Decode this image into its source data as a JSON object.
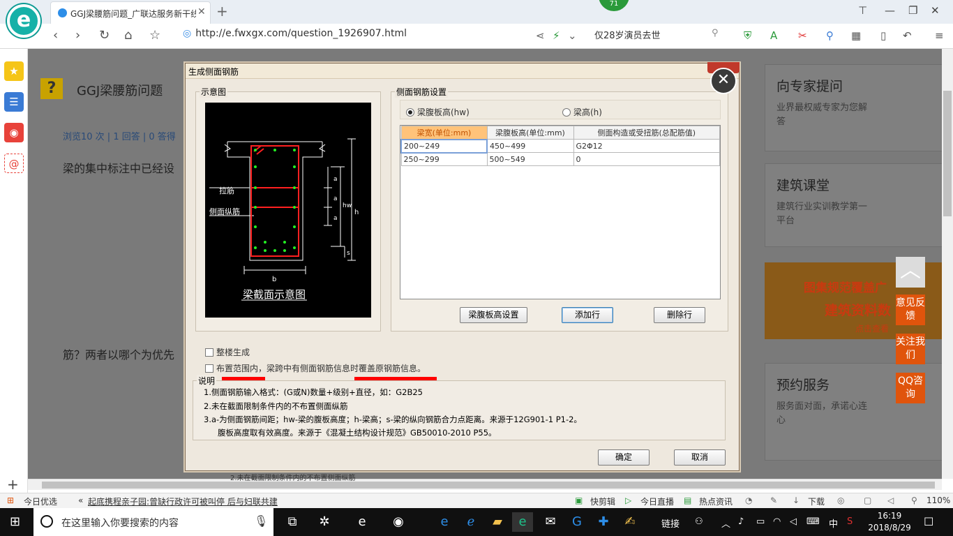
{
  "browser": {
    "tab_title": "GGJ梁腰筋问题_广联达服务新干线",
    "url": "http://e.fwxgx.com/question_1926907.html",
    "hot_search": "仅28岁演员去世",
    "badge": "71"
  },
  "page": {
    "title": "GGJ梁腰筋问题",
    "meta": "浏览10 次 | 1 回答 | 0 答得",
    "body_line1": "梁的集中标注中已经设",
    "body_line2": "筋？两者以哪个为优先"
  },
  "right_cards": [
    {
      "heading": "向专家提问",
      "sub": "业界最权威专家为您解答"
    },
    {
      "heading": "建筑课堂",
      "sub": "建筑行业实训教学第一平台"
    },
    {
      "heading": "预约服务",
      "sub": "服务面对面，承诺心连心"
    }
  ],
  "banner": {
    "line1": "图集规范覆盖广",
    "line2": "建筑资料数",
    "line3": "点击查看"
  },
  "float_buttons": [
    "意见反馈",
    "关注我们",
    "QQ咨询"
  ],
  "dialog": {
    "title": "生成侧面钢筋",
    "schematic_label": "示意图",
    "schematic_caption": "梁截面示意图",
    "schematic_tags": {
      "tie": "拉筋",
      "side": "侧面纵筋",
      "a": "a",
      "hw": "hw",
      "h": "h",
      "s": "s",
      "b": "b"
    },
    "settings_label": "侧面钢筋设置",
    "radio_web_height": "梁腹板高(hw)",
    "radio_beam_height": "梁高(h)",
    "grid_headers": [
      "梁宽(单位:mm)",
      "梁腹板高(单位:mm)",
      "侧面构造或受扭筋(总配筋值)"
    ],
    "grid_rows": [
      [
        "200~249",
        "450~499",
        "G2Φ12"
      ],
      [
        "250~299",
        "500~549",
        "0"
      ]
    ],
    "btn_web_height": "梁腹板高设置",
    "btn_add_row": "添加行",
    "btn_delete_row": "删除行",
    "chk_whole_building": "整楼生成",
    "chk_cover": "布置范围内，梁跨中有侧面钢筋信息时覆盖原钢筋信息。",
    "notes_label": "说明",
    "notes": [
      "1.侧面钢筋输入格式：(G或N)数量+级别+直径，如：G2B25",
      "2.未在截面限制条件内的不布置侧面纵筋",
      "3.a-为侧面钢筋间距；hw-梁的腹板高度；h-梁高；s-梁的纵向钢筋合力点距离。来源于12G901-1 P1-2。",
      "腹板高度取有效高度。来源于《混凝土结构设计规范》GB50010-2010 P55。"
    ],
    "btn_ok": "确定",
    "btn_cancel": "取消",
    "hidden_behind": "2.未在截面限制条件内的不布置侧面纵筋"
  },
  "statusbar": {
    "news_label": "今日优选",
    "news_text": "起底携程亲子园:曾缺行政许可被叫停 后与妇联共建",
    "items": [
      "快剪辑",
      "今日直播",
      "热点资讯",
      "下载"
    ],
    "zoom": "110%"
  },
  "taskbar": {
    "search_placeholder": "在这里输入你要搜索的内容",
    "link_label": "链接",
    "ime": "中",
    "time": "16:19",
    "date": "2018/8/29"
  },
  "colors": {
    "accent_orange": "#e0540c",
    "grid_header_sel": "#ffc37a",
    "annotation_red": "#ff0000"
  }
}
